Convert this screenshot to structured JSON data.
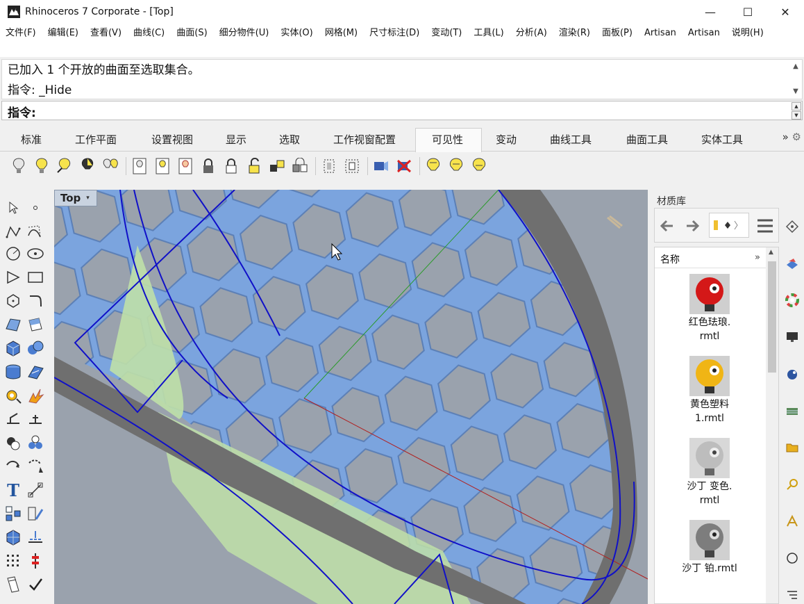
{
  "window": {
    "title": "Rhinoceros 7 Corporate - [Top]",
    "minimize": "—",
    "maximize": "☐",
    "close": "✕"
  },
  "menu": [
    "文件(F)",
    "编辑(E)",
    "查看(V)",
    "曲线(C)",
    "曲面(S)",
    "细分物件(U)",
    "实体(O)",
    "网格(M)",
    "尺寸标注(D)",
    "变动(T)",
    "工具(L)",
    "分析(A)",
    "渲染(R)",
    "面板(P)",
    "Artisan",
    "Artisan",
    "说明(H)"
  ],
  "command": {
    "history_line1": "已加入 1 个开放的曲面至选取集合。",
    "history_line2": "指令: _Hide",
    "prompt": "指令:"
  },
  "tabs": [
    {
      "label": "标准",
      "active": false
    },
    {
      "label": "工作平面",
      "active": false
    },
    {
      "label": "设置视图",
      "active": false
    },
    {
      "label": "显示",
      "active": false
    },
    {
      "label": "选取",
      "active": false
    },
    {
      "label": "工作视窗配置",
      "active": false
    },
    {
      "label": "可见性",
      "active": true
    },
    {
      "label": "变动",
      "active": false
    },
    {
      "label": "曲线工具",
      "active": false
    },
    {
      "label": "曲面工具",
      "active": false
    },
    {
      "label": "实体工具",
      "active": false
    }
  ],
  "tabs_more": "»",
  "viewport": {
    "label": "Top",
    "dropdown": "▾"
  },
  "material_panel": {
    "title": "材质库",
    "column": "名称",
    "more": "»",
    "items": [
      {
        "label": "红色珐琅.\nrmtl",
        "color": "#d41818"
      },
      {
        "label": "黄色塑料\n1.rmtl",
        "color": "#f0b515"
      },
      {
        "label": "沙丁 变色.\nrmtl",
        "color": "#bdbdbd"
      },
      {
        "label": "沙丁 铂.rmtl",
        "color": "#7d7d7d"
      }
    ]
  },
  "colors": {
    "hex_fill": "#7ba4de",
    "viewport_bg": "#9aa2ad",
    "curve": "#1010c8",
    "rim": "#6f6f6f",
    "surface_green": "#bfe0a8"
  }
}
